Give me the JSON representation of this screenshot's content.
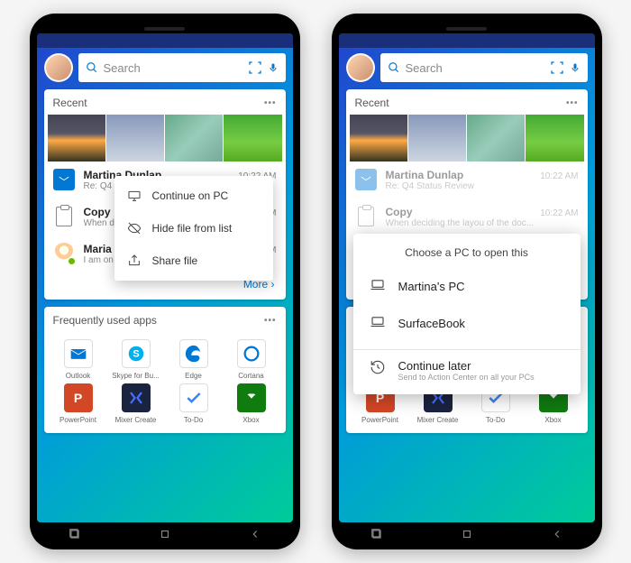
{
  "search": {
    "placeholder": "Search"
  },
  "recent": {
    "title": "Recent",
    "items": [
      {
        "title": "Martina Dunlap",
        "time": "10:22 AM",
        "sub": "Re: Q4 Status Review"
      },
      {
        "title": "Copy",
        "time": "10:22 AM",
        "sub": "When deciding the layou of the doc..."
      },
      {
        "title": "Maria Dunlap",
        "time": "10:28 AM",
        "sub": "I am on my way."
      }
    ],
    "more": "More"
  },
  "frequent": {
    "title": "Frequently used apps",
    "apps": [
      {
        "label": "Outlook"
      },
      {
        "label": "Skype for Bu..."
      },
      {
        "label": "Edge"
      },
      {
        "label": "Cortana"
      },
      {
        "label": "PowerPoint"
      },
      {
        "label": "Mixer Create"
      },
      {
        "label": "To-Do"
      },
      {
        "label": "Xbox"
      }
    ]
  },
  "context_menu": {
    "items": [
      "Continue on PC",
      "Hide file from list",
      "Share file"
    ]
  },
  "pc_dialog": {
    "title": "Choose a PC to open this",
    "pcs": [
      "Martina's PC",
      "SurfaceBook"
    ],
    "later_title": "Continue later",
    "later_sub": "Send to Action Center on all your PCs"
  }
}
